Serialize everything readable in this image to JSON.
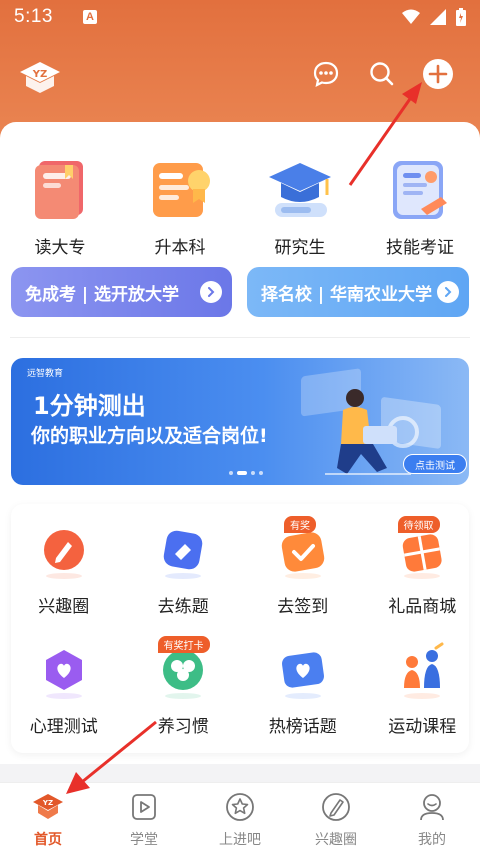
{
  "status_bar": {
    "time": "5:13",
    "notification": "A"
  },
  "header": {
    "logo_text": "YZ"
  },
  "categories": [
    {
      "label": "读大专",
      "icon": "book-icon"
    },
    {
      "label": "升本科",
      "icon": "certificate-icon"
    },
    {
      "label": "研究生",
      "icon": "graduation-cap-icon"
    },
    {
      "label": "技能考证",
      "icon": "license-card-icon"
    }
  ],
  "promo_buttons": [
    {
      "label": "免成考 | 选开放大学"
    },
    {
      "label": "择名校 | 华南农业大学"
    }
  ],
  "banner": {
    "brand": "远智教育",
    "title": "1分钟测出",
    "subtitle": "你的职业方向以及适合岗位!",
    "button": "点击测试"
  },
  "features_row1": [
    {
      "label": "兴趣圈",
      "icon": "pencil-icon",
      "tag": ""
    },
    {
      "label": "去练题",
      "icon": "eraser-icon",
      "tag": ""
    },
    {
      "label": "去签到",
      "icon": "checkin-icon",
      "tag": "有奖"
    },
    {
      "label": "礼品商城",
      "icon": "gift-icon",
      "tag": "待领取"
    }
  ],
  "features_row2": [
    {
      "label": "心理测试",
      "icon": "heart-chat-icon",
      "tag": ""
    },
    {
      "label": "养习惯",
      "icon": "clover-icon",
      "tag": "有奖打卡"
    },
    {
      "label": "热榜话题",
      "icon": "heart-screen-icon",
      "tag": ""
    },
    {
      "label": "运动课程",
      "icon": "sport-people-icon",
      "tag": ""
    }
  ],
  "tabs": [
    {
      "label": "首页",
      "icon": "home-logo-icon",
      "active": true
    },
    {
      "label": "学堂",
      "icon": "play-icon",
      "active": false
    },
    {
      "label": "上进吧",
      "icon": "star-icon",
      "active": false
    },
    {
      "label": "兴趣圈",
      "icon": "pen-circle-icon",
      "active": false
    },
    {
      "label": "我的",
      "icon": "profile-icon",
      "active": false
    }
  ],
  "colors": {
    "brand_orange": "#e2703e",
    "active_tab": "#e2582a",
    "annotation_red": "#e8302a"
  }
}
